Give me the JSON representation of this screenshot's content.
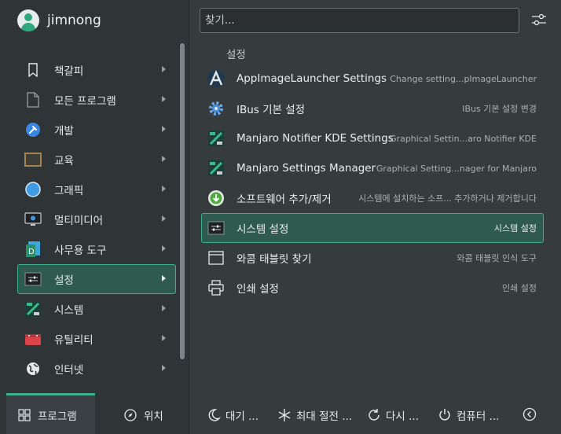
{
  "user": {
    "name": "jimnong"
  },
  "categories": [
    {
      "label": "책갈피",
      "icon": "bookmark-icon"
    },
    {
      "label": "모든 프로그램",
      "icon": "document-icon"
    },
    {
      "label": "개발",
      "icon": "hammer-icon"
    },
    {
      "label": "교육",
      "icon": "chalkboard-icon"
    },
    {
      "label": "그래픽",
      "icon": "graphics-icon"
    },
    {
      "label": "멀티미디어",
      "icon": "monitor-icon"
    },
    {
      "label": "사무용 도구",
      "icon": "office-icon"
    },
    {
      "label": "설정",
      "icon": "settings-icon"
    },
    {
      "label": "시스템",
      "icon": "manjaro-icon"
    },
    {
      "label": "유틸리티",
      "icon": "toolbox-icon"
    },
    {
      "label": "인터넷",
      "icon": "globe-icon"
    }
  ],
  "active_category": "설정",
  "search": {
    "placeholder": "찾기..."
  },
  "section_title": "설정",
  "results": [
    {
      "name": "AppImageLauncher Settings",
      "desc": "Change setting...pImageLauncher",
      "icon": "appimage-icon"
    },
    {
      "name": "IBus 기본 설정",
      "desc": "IBus 기본 설정 변경",
      "icon": "gear-icon"
    },
    {
      "name": "Manjaro Notifier KDE Settings",
      "desc": "Graphical Settin...aro Notifier KDE",
      "icon": "manjaro-icon"
    },
    {
      "name": "Manjaro Settings Manager",
      "desc": "Graphical Setting...nager for Manjaro",
      "icon": "manjaro-icon"
    },
    {
      "name": "소프트웨어 추가/제거",
      "desc": "시스템에 설치하는 소프... 추가하거나 제거합니다",
      "icon": "download-icon"
    },
    {
      "name": "시스템 설정",
      "desc": "시스템 설정",
      "icon": "system-settings-icon"
    },
    {
      "name": "와콤 태블릿 찾기",
      "desc": "와콤 태블릿 인식 도구",
      "icon": "window-icon"
    },
    {
      "name": "인쇄 설정",
      "desc": "인쇄 설정",
      "icon": "printer-icon"
    }
  ],
  "active_result": "시스템 설정",
  "tabs": {
    "programs": "프로그램",
    "places": "위치"
  },
  "power": {
    "sleep": "대기 ...",
    "hibernate": "최대 절전 ...",
    "restart": "다시 ...",
    "shutdown": "컴퓨터 ..."
  },
  "colors": {
    "accent": "#3fb08c",
    "highlight": "#2f5a50",
    "bg_left": "#2f3437",
    "bg_right": "#363b3e"
  }
}
